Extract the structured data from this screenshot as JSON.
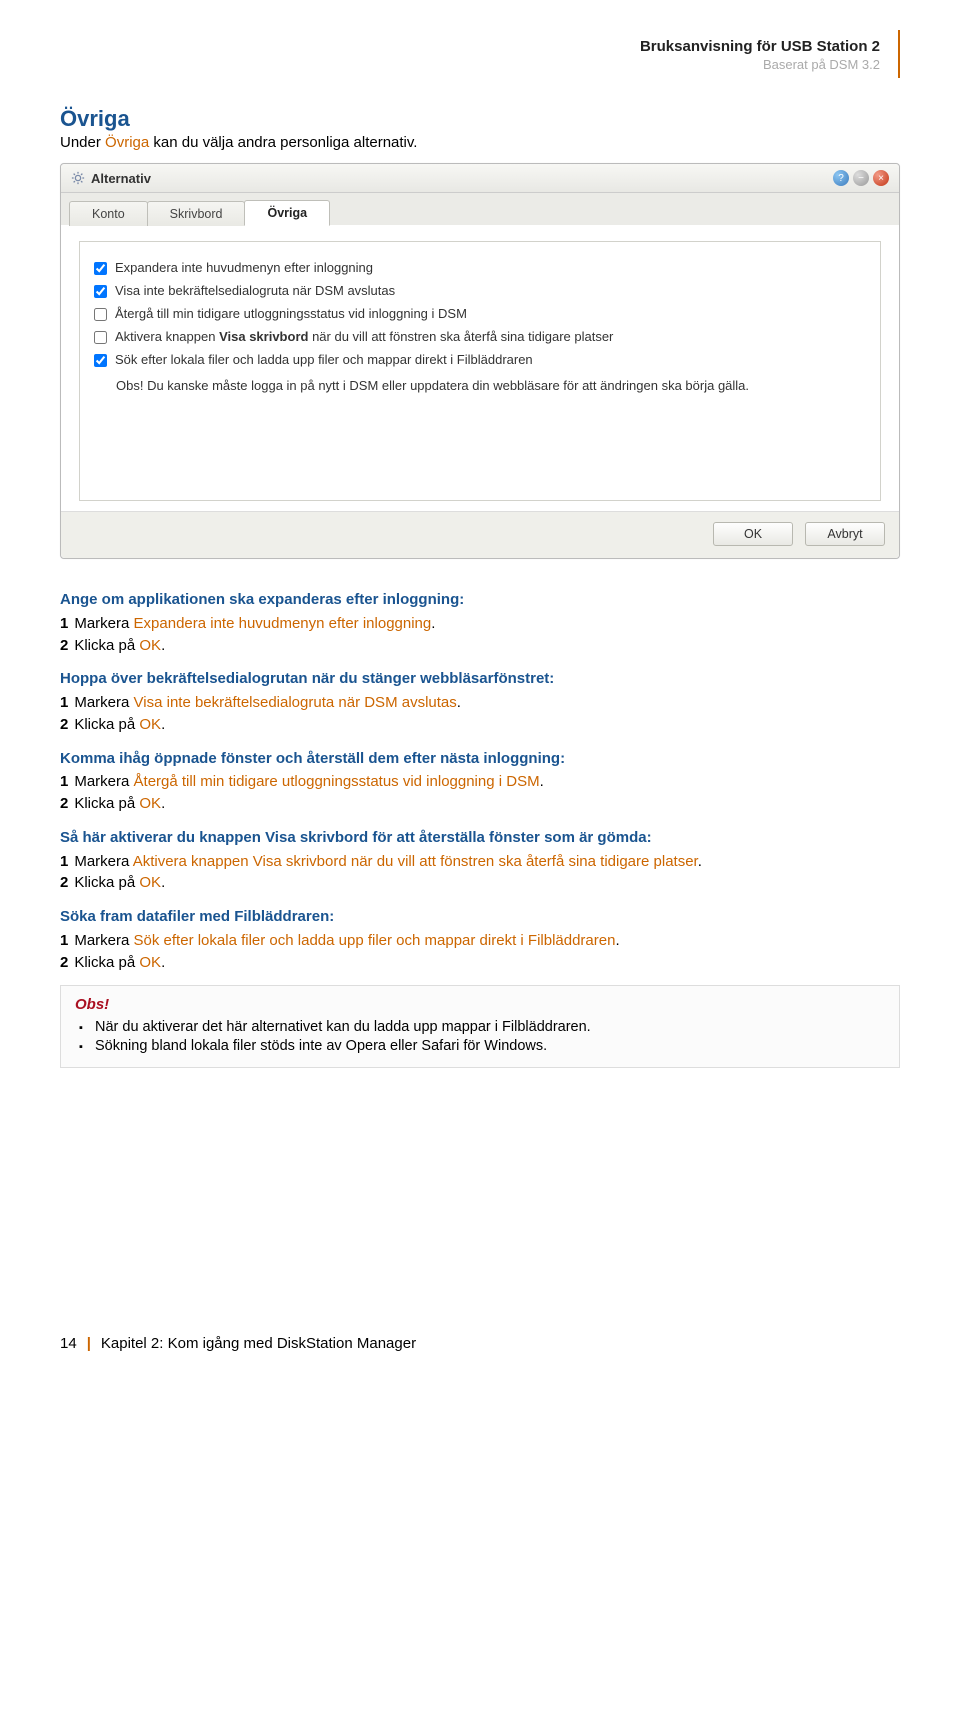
{
  "header": {
    "title": "Bruksanvisning för USB Station 2",
    "subtitle": "Baserat på DSM 3.2"
  },
  "section_title": "Övriga",
  "intro_prefix": "Under ",
  "intro_highlight": "Övriga",
  "intro_suffix": " kan du välja andra personliga alternativ.",
  "screenshot": {
    "window_title": "Alternativ",
    "tabs": [
      "Konto",
      "Skrivbord",
      "Övriga"
    ],
    "active_tab": 2,
    "checkboxes": [
      {
        "checked": true,
        "label": "Expandera inte huvudmenyn efter inloggning"
      },
      {
        "checked": true,
        "label": "Visa inte bekräftelsedialogruta när DSM avslutas"
      },
      {
        "checked": false,
        "label": "Återgå till min tidigare utloggningsstatus vid inloggning i DSM"
      },
      {
        "checked": false,
        "label_prefix": "Aktivera knappen ",
        "label_bold": "Visa skrivbord",
        "label_suffix": " när du vill att fönstren ska återfå sina tidigare platser"
      },
      {
        "checked": true,
        "label": "Sök efter lokala filer och ladda upp filer och mappar direkt i Filbläddraren"
      }
    ],
    "note": "Obs! Du kanske måste logga in på nytt i DSM eller uppdatera din webbläsare för att ändringen ska börja gälla.",
    "buttons": {
      "ok": "OK",
      "cancel": "Avbryt"
    }
  },
  "blocks": [
    {
      "title": "Ange om applikationen ska expanderas efter inloggning:",
      "step1_num": "1",
      "step1_text": "Markera ",
      "step1_orange": "Expandera inte huvudmenyn efter inloggning",
      "step1_suffix": ".",
      "step2_num": "2",
      "step2_text": "Klicka på ",
      "step2_orange": "OK",
      "step2_suffix": "."
    },
    {
      "title": "Hoppa över bekräftelsedialogrutan när du stänger webbläsarfönstret:",
      "step1_num": "1",
      "step1_text": "Markera ",
      "step1_orange": "Visa inte bekräftelsedialogruta när DSM avslutas",
      "step1_suffix": ".",
      "step2_num": "2",
      "step2_text": "Klicka på ",
      "step2_orange": "OK",
      "step2_suffix": "."
    },
    {
      "title": "Komma ihåg öppnade fönster och återställ dem efter nästa inloggning:",
      "step1_num": "1",
      "step1_text": "Markera ",
      "step1_orange": "Återgå till min tidigare utloggningsstatus vid inloggning i DSM",
      "step1_suffix": ".",
      "step2_num": "2",
      "step2_text": "Klicka på ",
      "step2_orange": "OK",
      "step2_suffix": "."
    },
    {
      "title": "Så här aktiverar du knappen Visa skrivbord för att återställa fönster som är gömda:",
      "step1_num": "1",
      "step1_text": "Markera ",
      "step1_orange": "Aktivera knappen Visa skrivbord när du vill att fönstren ska återfå sina tidigare platser",
      "step1_suffix": ".",
      "step2_num": "2",
      "step2_text": "Klicka på ",
      "step2_orange": "OK",
      "step2_suffix": "."
    },
    {
      "title": "Söka fram datafiler med Filbläddraren:",
      "step1_num": "1",
      "step1_text": "Markera ",
      "step1_orange": "Sök efter lokala filer och ladda upp filer och mappar direkt i Filbläddraren",
      "step1_suffix": ".",
      "step2_num": "2",
      "step2_text": "Klicka på ",
      "step2_orange": "OK",
      "step2_suffix": "."
    }
  ],
  "obs": {
    "title": "Obs!",
    "items": [
      "När du aktiverar det här alternativet kan du ladda upp mappar i Filbläddraren.",
      "Sökning bland lokala filer stöds inte av Opera eller Safari för Windows."
    ]
  },
  "footer": {
    "page_number": "14",
    "chapter": "Kapitel 2: Kom igång med DiskStation Manager"
  }
}
